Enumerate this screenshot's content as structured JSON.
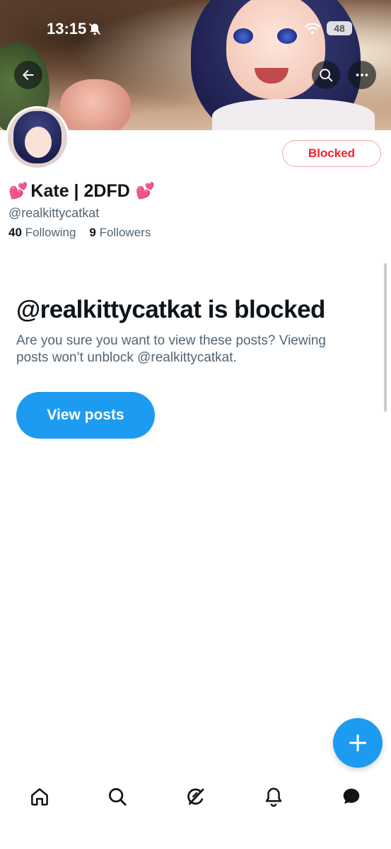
{
  "status_bar": {
    "time": "13:15",
    "battery": "48"
  },
  "profile": {
    "display_name": "Kate | 2DFD",
    "heart_left": "💕",
    "heart_right": "💕",
    "handle": "@realkittycatkat",
    "following_count": "40",
    "following_label": "Following",
    "followers_count": "9",
    "followers_label": "Followers",
    "blocked_button": "Blocked"
  },
  "blocked_notice": {
    "title": "@realkittycatkat is blocked",
    "description": "Are you sure you want to view these posts? Viewing posts won’t unblock @realkittycatkat.",
    "view_posts_label": "View posts"
  },
  "colors": {
    "accent": "#1d9bf0",
    "blocked": "#f4212e",
    "muted": "#536471"
  },
  "icons": {
    "top_bar": [
      "back-arrow-icon",
      "search-icon",
      "more-icon"
    ],
    "bottom_nav": [
      "home-icon",
      "search-icon",
      "grok-icon",
      "notifications-icon",
      "messages-icon"
    ],
    "fab": "plus-icon"
  }
}
